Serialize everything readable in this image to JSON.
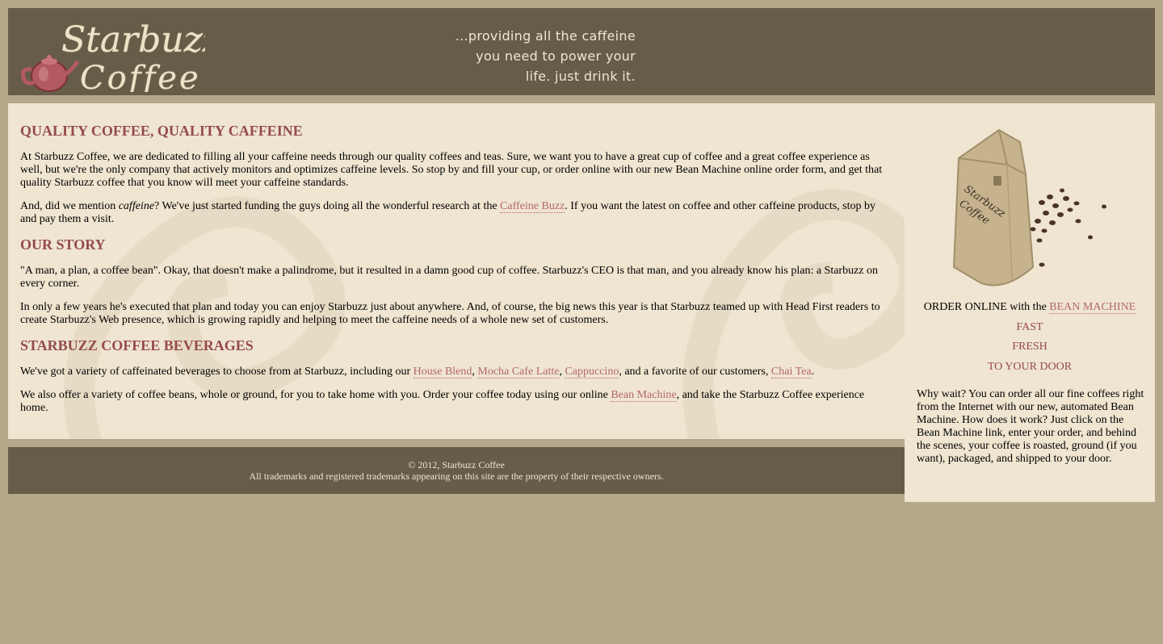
{
  "header": {
    "logo_text": [
      "Starbuzz",
      "Coffee"
    ],
    "slogan": [
      "...providing all the caffeine",
      "you need to power your",
      "life. just drink it."
    ]
  },
  "main": {
    "sections": [
      {
        "heading": "QUALITY COFFEE, QUALITY CAFFEINE",
        "p1": "At Starbuzz Coffee, we are dedicated to filling all your caffeine needs through our quality coffees and teas. Sure, we want you to have a great cup of coffee and a great coffee experience as well, but we're the only company that actively monitors and optimizes caffeine levels. So stop by and fill your cup, or order online with our new Bean Machine online order form, and get that quality Starbuzz coffee that you know will meet your caffeine standards.",
        "p2_pre": "And, did we mention ",
        "p2_em": "caffeine",
        "p2_mid": "? We've just started funding the guys doing all the wonderful research at the ",
        "p2_link": "Caffeine Buzz",
        "p2_post": ". If you want the latest on coffee and other caffeine products, stop by and pay them a visit."
      },
      {
        "heading": "OUR STORY",
        "p1": "\"A man, a plan, a coffee bean\". Okay, that doesn't make a palindrome, but it resulted in a damn good cup of coffee. Starbuzz's CEO is that man, and you already know his plan: a Starbuzz on every corner.",
        "p2": "In only a few years he's executed that plan and today you can enjoy Starbuzz just about anywhere. And, of course, the big news this year is that Starbuzz teamed up with Head First readers to create Starbuzz's Web presence, which is growing rapidly and helping to meet the caffeine needs of a whole new set of customers."
      },
      {
        "heading": "STARBUZZ COFFEE BEVERAGES",
        "p1_pre": "We've got a variety of caffeinated beverages to choose from at Starbuzz, including our ",
        "links": [
          "House Blend",
          "Mocha Cafe Latte",
          "Cappuccino",
          "Chai Tea"
        ],
        "sep1": ", ",
        "sep2": ", ",
        "sep3": ", and a favorite of our customers, ",
        "p1_post": ".",
        "p2_pre": "We also offer a variety of coffee beans, whole or ground, for you to take home with you. Order your coffee today using our online ",
        "p2_link": "Bean Machine",
        "p2_post": ", and take the Starbuzz Coffee experience home."
      }
    ]
  },
  "sidebar": {
    "bag_text": [
      "Starbuzz",
      "Coffee"
    ],
    "order_pre": "ORDER ONLINE with the ",
    "order_link": "BEAN MACHINE",
    "pitch": [
      "FAST",
      "FRESH",
      "TO YOUR DOOR"
    ],
    "why": "Why wait? You can order all our fine coffees right from the Internet with our new, automated Bean Machine. How does it work? Just click on the Bean Machine link, enter your order, and behind the scenes, your coffee is roasted, ground (if you want), packaged, and shipped to your door."
  },
  "footer": {
    "copyright": "© 2012, Starbuzz Coffee",
    "trademark": "All trademarks and registered trademarks appearing on this site are the property of their respective owners."
  },
  "colors": {
    "page_bg": "#b5a789",
    "band": "#675c47",
    "panel": "#efe5d0",
    "heading": "#954b4b",
    "link": "#b5666a"
  }
}
